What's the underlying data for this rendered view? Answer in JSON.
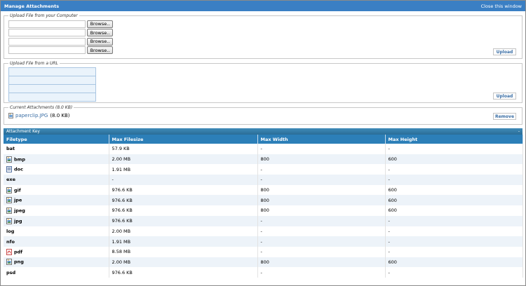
{
  "header": {
    "title": "Manage Attachments",
    "close_label": "Close this window"
  },
  "upload_computer": {
    "legend": "Upload File from your Computer",
    "browse_label": "Browse..",
    "upload_label": "Upload"
  },
  "upload_url": {
    "legend": "Upload File from a URL",
    "upload_label": "Upload"
  },
  "current": {
    "legend": "Current Attachments (8.0 KB)",
    "file_name": "paperclip.JPG",
    "file_size": "(8.0 KB)",
    "remove_label": "Remove"
  },
  "key": {
    "title": "Attachment Key",
    "collapse": "-",
    "columns": [
      "Filetype",
      "Max Filesize",
      "Max Width",
      "Max Height"
    ],
    "rows": [
      {
        "type": "bat",
        "icon": "none",
        "size": "57.9 KB",
        "width": "-",
        "height": "-"
      },
      {
        "type": "bmp",
        "icon": "image-file-icon",
        "size": "2.00 MB",
        "width": "800",
        "height": "600"
      },
      {
        "type": "doc",
        "icon": "document-file-icon",
        "size": "1.91 MB",
        "width": "-",
        "height": "-"
      },
      {
        "type": "exe",
        "icon": "none",
        "size": "-",
        "width": "-",
        "height": "-"
      },
      {
        "type": "gif",
        "icon": "image-file-icon",
        "size": "976.6 KB",
        "width": "800",
        "height": "600"
      },
      {
        "type": "jpe",
        "icon": "image-file-icon",
        "size": "976.6 KB",
        "width": "800",
        "height": "600"
      },
      {
        "type": "jpeg",
        "icon": "image-file-icon",
        "size": "976.6 KB",
        "width": "800",
        "height": "600"
      },
      {
        "type": "jpg",
        "icon": "image-file-icon",
        "size": "976.6 KB",
        "width": "-",
        "height": "-"
      },
      {
        "type": "log",
        "icon": "none",
        "size": "2.00 MB",
        "width": "-",
        "height": "-"
      },
      {
        "type": "nfo",
        "icon": "none",
        "size": "1.91 MB",
        "width": "-",
        "height": "-"
      },
      {
        "type": "pdf",
        "icon": "pdf-file-icon",
        "size": "8.58 MB",
        "width": "-",
        "height": "-"
      },
      {
        "type": "png",
        "icon": "image-file-icon",
        "size": "2.00 MB",
        "width": "800",
        "height": "600"
      },
      {
        "type": "psd",
        "icon": "none",
        "size": "976.6 KB",
        "width": "-",
        "height": "-"
      }
    ]
  }
}
